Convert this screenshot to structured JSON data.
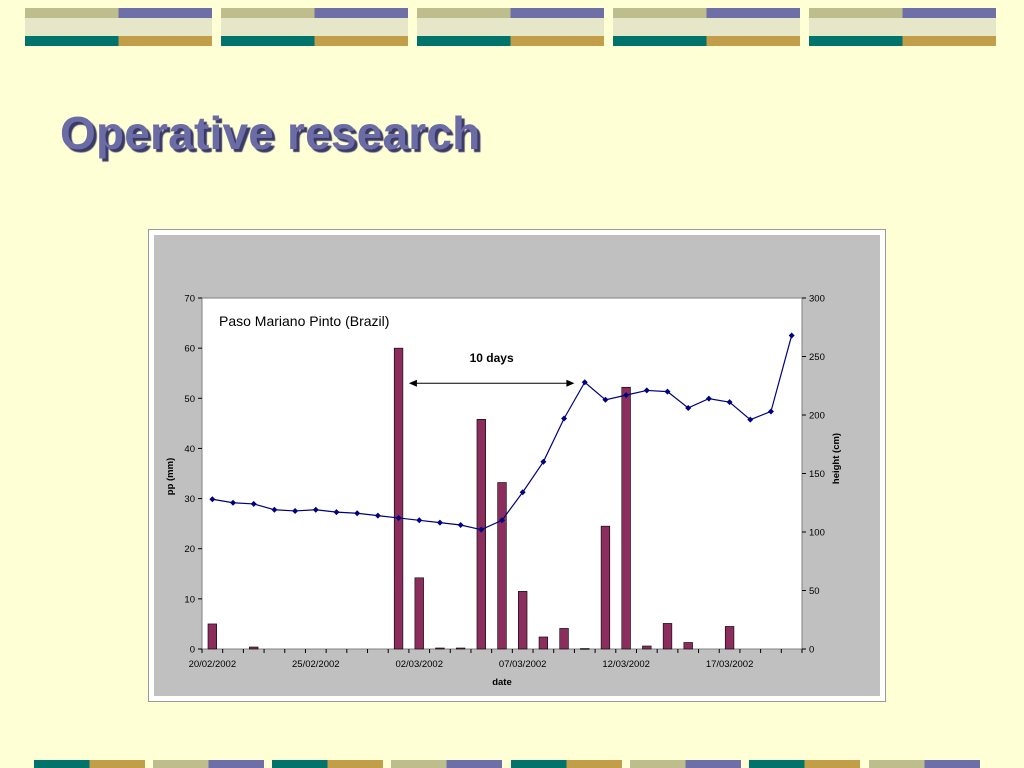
{
  "slide": {
    "title": "Operative research"
  },
  "colors": {
    "background": "#FFFFD5",
    "title": "#6B6BA6",
    "deco_khaki": "#BDBD8E",
    "deco_purple": "#6F6FA8",
    "deco_teal": "#00736B",
    "deco_gold": "#C29E48",
    "deco_light": "#E6E6C8",
    "plot_area": "#FFFFFF",
    "chart_bg": "#C0C0C0",
    "bars": "#8B2E5E",
    "line": "#000080"
  },
  "chart_data": {
    "type": "bar",
    "title": "Paso Mariano Pinto (Brazil)",
    "xlabel": "date",
    "ylabel_left": "pp (mm)",
    "ylabel_right": "height (cm)",
    "ylim_left": [
      0,
      70
    ],
    "ylim_right": [
      0,
      300
    ],
    "y_ticks_left": [
      "0",
      "10",
      "20",
      "30",
      "40",
      "50",
      "60",
      "70"
    ],
    "y_ticks_right": [
      "0",
      "50",
      "100",
      "150",
      "200",
      "250",
      "300"
    ],
    "x_tick_labels": [
      "20/02/2002",
      "25/02/2002",
      "02/03/2002",
      "07/03/2002",
      "12/03/2002",
      "17/03/2002"
    ],
    "x_tick_positions": [
      0,
      5,
      10,
      15,
      20,
      25
    ],
    "day_count": 29,
    "grid": false,
    "legend": "none",
    "annotation": {
      "text": "10 days",
      "from_day": 9.5,
      "to_day": 17.5,
      "at_pp": 53
    },
    "series": [
      {
        "type": "bar",
        "axis": "left",
        "values": [
          5,
          0,
          0.4,
          0,
          0,
          0,
          0,
          0,
          0,
          60,
          14.2,
          0.2,
          0.2,
          45.8,
          33.2,
          11.5,
          2.4,
          4.1,
          0.1,
          24.5,
          52.2,
          0.6,
          5.1,
          1.3,
          0,
          4.5,
          0,
          0,
          0
        ]
      },
      {
        "type": "line",
        "axis": "right",
        "values": [
          128,
          125,
          124,
          119,
          118,
          119,
          117,
          116,
          114,
          112,
          110,
          108,
          106,
          102,
          110,
          134,
          160,
          197,
          228,
          213,
          217,
          221,
          220,
          206,
          214,
          211,
          196,
          203,
          268
        ]
      }
    ]
  }
}
